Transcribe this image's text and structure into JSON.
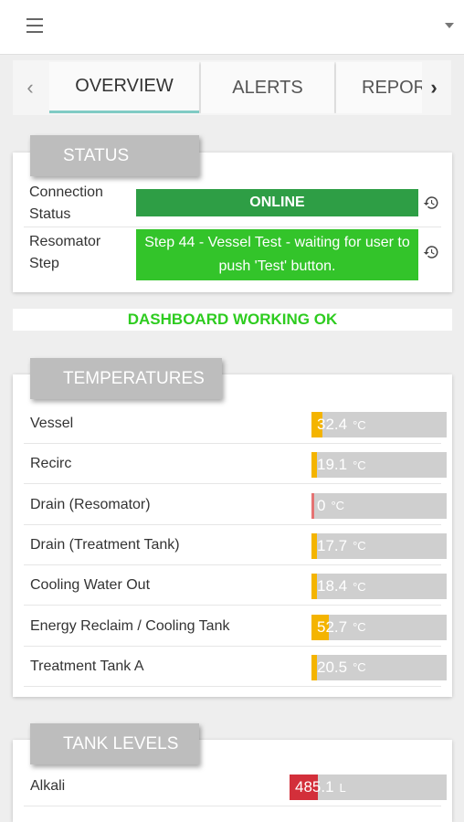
{
  "header": {
    "menu_icon": "hamburger-icon",
    "dropdown_icon": "caret-down-icon"
  },
  "tabs": {
    "prev_icon": "chevron-left-icon",
    "next_icon": "chevron-right-icon",
    "items": [
      {
        "label": "OVERVIEW",
        "active": true
      },
      {
        "label": "ALERTS",
        "active": false
      },
      {
        "label": "REPOR",
        "active": false
      }
    ]
  },
  "status": {
    "title": "STATUS",
    "rows": [
      {
        "label_line1": "Connection",
        "label_line2": "Status",
        "value": "ONLINE",
        "color": "#2e9e45",
        "icon": "history-icon"
      },
      {
        "label_line1": "Resomator",
        "label_line2": "Step",
        "value": "Step 44 - Vessel Test - waiting for user to push 'Test' button.",
        "color": "#33c42a",
        "icon": "history-icon"
      }
    ]
  },
  "banner": {
    "text": "DASHBOARD WORKING OK",
    "color": "#2ecc20"
  },
  "temperatures": {
    "title": "TEMPERATURES",
    "unit": "°C",
    "rows": [
      {
        "label": "Vessel",
        "value": "32.4",
        "fill_fraction": 0.08,
        "fill_color": "#f4b400"
      },
      {
        "label": "Recirc",
        "value": "19.1",
        "fill_fraction": 0.04,
        "fill_color": "#f4b400"
      },
      {
        "label": "Drain (Resomator)",
        "value": "0",
        "fill_fraction": 0.01,
        "fill_color": "#e57373"
      },
      {
        "label": "Drain (Treatment Tank)",
        "value": "17.7",
        "fill_fraction": 0.04,
        "fill_color": "#f4b400"
      },
      {
        "label": "Cooling Water Out",
        "value": "18.4",
        "fill_fraction": 0.04,
        "fill_color": "#f4b400"
      },
      {
        "label": "Energy Reclaim / Cooling Tank",
        "value": "52.7",
        "fill_fraction": 0.13,
        "fill_color": "#f4b400"
      },
      {
        "label": "Treatment Tank A",
        "value": "20.5",
        "fill_fraction": 0.04,
        "fill_color": "#f4b400"
      }
    ]
  },
  "tank_levels": {
    "title": "TANK LEVELS",
    "unit": "L",
    "rows": [
      {
        "label": "Alkali",
        "value": "485.1",
        "fill_fraction": 0.18,
        "fill_color": "#d32f3a"
      }
    ]
  }
}
